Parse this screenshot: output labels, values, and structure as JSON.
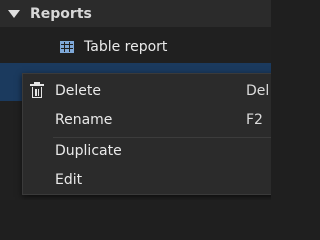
{
  "tree": {
    "section_title": "Reports",
    "section_icon": "caret-down-icon",
    "items": [
      {
        "label": "Table report",
        "icon": "table-icon"
      }
    ]
  },
  "context_menu": {
    "items": [
      {
        "label": "Delete",
        "shortcut": "Del",
        "icon": "trash-icon"
      },
      {
        "label": "Rename",
        "shortcut": "F2"
      },
      {
        "label": "Duplicate",
        "shortcut": ""
      },
      {
        "label": "Edit",
        "shortcut": ""
      }
    ]
  },
  "colors": {
    "background": "#202020",
    "header_background": "#2b2b2b",
    "selection": "#1b3a5e",
    "menu_background": "#2b2b2b",
    "text": "#eaeaea",
    "table_icon": "#7ea8d8"
  }
}
